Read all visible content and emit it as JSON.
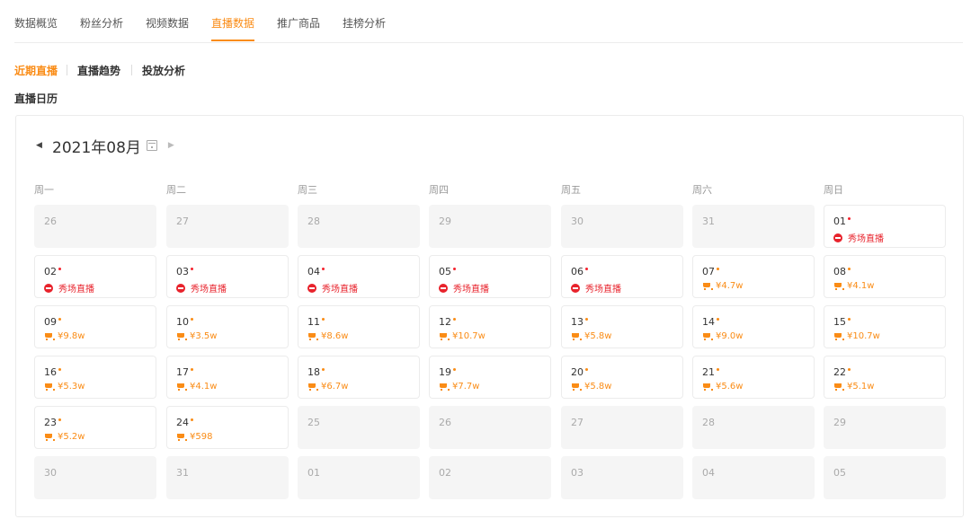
{
  "top_tabs": [
    "数据概览",
    "粉丝分析",
    "视频数据",
    "直播数据",
    "推广商品",
    "挂榜分析"
  ],
  "sub_tabs": [
    "近期直播",
    "直播趋势",
    "投放分析"
  ],
  "section_title": "直播日历",
  "calendar": {
    "month": "2021年08月",
    "weekdays": [
      "周一",
      "周二",
      "周三",
      "周四",
      "周五",
      "周六",
      "周日"
    ],
    "show_label": "秀场直播",
    "rows": [
      [
        {
          "day": "26",
          "state": "muted"
        },
        {
          "day": "27",
          "state": "muted"
        },
        {
          "day": "28",
          "state": "muted"
        },
        {
          "day": "29",
          "state": "muted"
        },
        {
          "day": "30",
          "state": "muted"
        },
        {
          "day": "31",
          "state": "muted"
        },
        {
          "day": "01",
          "state": "show"
        }
      ],
      [
        {
          "day": "02",
          "state": "show"
        },
        {
          "day": "03",
          "state": "show"
        },
        {
          "day": "04",
          "state": "show"
        },
        {
          "day": "05",
          "state": "show"
        },
        {
          "day": "06",
          "state": "show"
        },
        {
          "day": "07",
          "state": "sale",
          "value": "¥4.7w"
        },
        {
          "day": "08",
          "state": "sale",
          "value": "¥4.1w"
        }
      ],
      [
        {
          "day": "09",
          "state": "sale",
          "value": "¥9.8w"
        },
        {
          "day": "10",
          "state": "sale",
          "value": "¥3.5w"
        },
        {
          "day": "11",
          "state": "sale",
          "value": "¥8.6w"
        },
        {
          "day": "12",
          "state": "sale",
          "value": "¥10.7w"
        },
        {
          "day": "13",
          "state": "sale",
          "value": "¥5.8w"
        },
        {
          "day": "14",
          "state": "sale",
          "value": "¥9.0w"
        },
        {
          "day": "15",
          "state": "sale",
          "value": "¥10.7w"
        }
      ],
      [
        {
          "day": "16",
          "state": "sale",
          "value": "¥5.3w"
        },
        {
          "day": "17",
          "state": "sale",
          "value": "¥4.1w"
        },
        {
          "day": "18",
          "state": "sale",
          "value": "¥6.7w"
        },
        {
          "day": "19",
          "state": "sale",
          "value": "¥7.7w"
        },
        {
          "day": "20",
          "state": "sale",
          "value": "¥5.8w"
        },
        {
          "day": "21",
          "state": "sale",
          "value": "¥5.6w"
        },
        {
          "day": "22",
          "state": "sale",
          "value": "¥5.1w"
        }
      ],
      [
        {
          "day": "23",
          "state": "sale",
          "value": "¥5.2w"
        },
        {
          "day": "24",
          "state": "sale",
          "value": "¥598"
        },
        {
          "day": "25",
          "state": "muted"
        },
        {
          "day": "26",
          "state": "muted"
        },
        {
          "day": "27",
          "state": "muted"
        },
        {
          "day": "28",
          "state": "muted"
        },
        {
          "day": "29",
          "state": "muted"
        }
      ],
      [
        {
          "day": "30",
          "state": "muted"
        },
        {
          "day": "31",
          "state": "muted"
        },
        {
          "day": "01",
          "state": "muted"
        },
        {
          "day": "02",
          "state": "muted"
        },
        {
          "day": "03",
          "state": "muted"
        },
        {
          "day": "04",
          "state": "muted"
        },
        {
          "day": "05",
          "state": "muted"
        }
      ]
    ]
  },
  "colors": {
    "accent": "#fa8c16",
    "live_red": "#e8232c"
  }
}
